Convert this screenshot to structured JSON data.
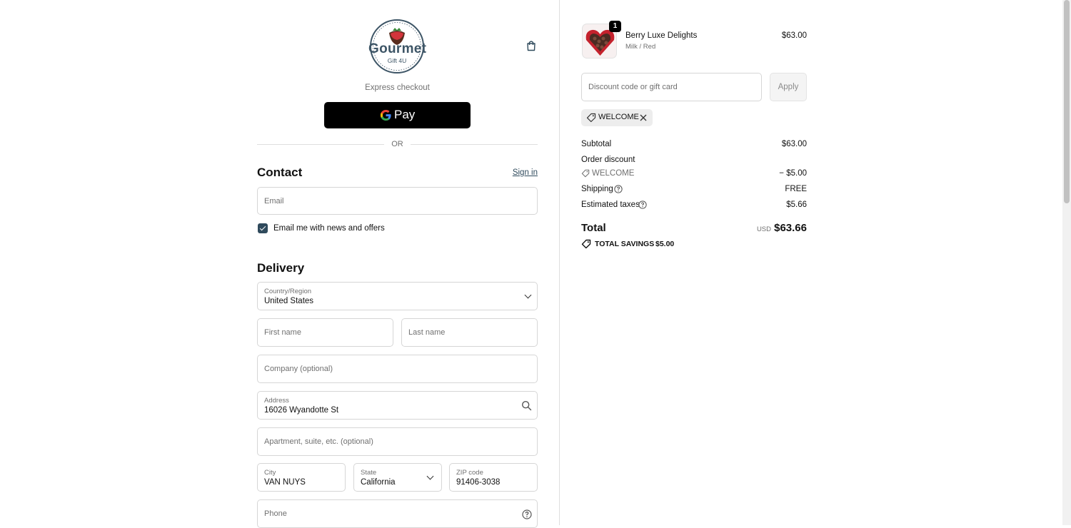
{
  "brand": {
    "name": "Gourmet",
    "tagline": "Gift 4U"
  },
  "express": {
    "label": "Express checkout",
    "gpay_label": "Pay",
    "or_label": "OR"
  },
  "contact": {
    "title": "Contact",
    "sign_in": "Sign in",
    "email_placeholder": "Email",
    "newsletter_label": "Email me with news and offers",
    "newsletter_checked": true
  },
  "delivery": {
    "title": "Delivery",
    "country_label": "Country/Region",
    "country_value": "United States",
    "first_name_placeholder": "First name",
    "last_name_placeholder": "Last name",
    "company_placeholder": "Company (optional)",
    "address_label": "Address",
    "address_value": "16026 Wyandotte St",
    "apartment_placeholder": "Apartment, suite, etc. (optional)",
    "city_label": "City",
    "city_value": "VAN NUYS",
    "state_label": "State",
    "state_value": "California",
    "zip_label": "ZIP code",
    "zip_value": "91406-3038",
    "phone_placeholder": "Phone"
  },
  "cart": {
    "item": {
      "quantity": "1",
      "name": "Berry Luxe Delights",
      "variant": "Milk / Red",
      "price": "$63.00"
    },
    "discount_placeholder": "Discount code or gift card",
    "apply_label": "Apply",
    "applied_code": "WELCOME"
  },
  "summary": {
    "subtotal_label": "Subtotal",
    "subtotal_value": "$63.00",
    "order_discount_label": "Order discount",
    "discount_code": "WELCOME",
    "discount_value": "− $5.00",
    "shipping_label": "Shipping",
    "shipping_value": "FREE",
    "taxes_label": "Estimated taxes",
    "taxes_value": "$5.66",
    "total_label": "Total",
    "currency": "USD",
    "total_value": "$63.66",
    "savings_label": "TOTAL SAVINGS",
    "savings_value": "$5.00"
  },
  "colors": {
    "accent": "#2f4a5c",
    "link": "#2f4a5c",
    "gpay_bg": "#000000",
    "checkbox": "#2f4a5c"
  }
}
